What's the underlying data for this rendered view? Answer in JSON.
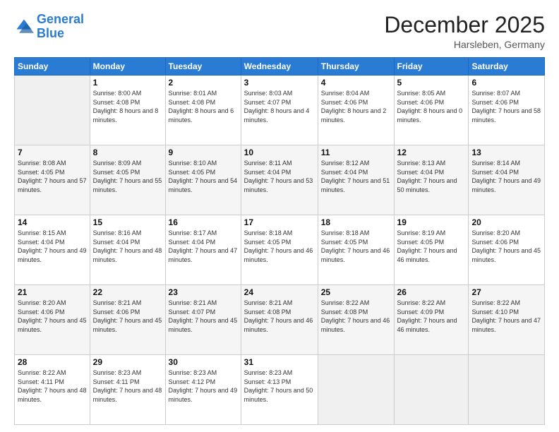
{
  "logo": {
    "line1": "General",
    "line2": "Blue"
  },
  "title": "December 2025",
  "location": "Harsleben, Germany",
  "header_days": [
    "Sunday",
    "Monday",
    "Tuesday",
    "Wednesday",
    "Thursday",
    "Friday",
    "Saturday"
  ],
  "weeks": [
    [
      {
        "day": "",
        "sunrise": "",
        "sunset": "",
        "daylight": ""
      },
      {
        "day": "1",
        "sunrise": "Sunrise: 8:00 AM",
        "sunset": "Sunset: 4:08 PM",
        "daylight": "Daylight: 8 hours and 8 minutes."
      },
      {
        "day": "2",
        "sunrise": "Sunrise: 8:01 AM",
        "sunset": "Sunset: 4:08 PM",
        "daylight": "Daylight: 8 hours and 6 minutes."
      },
      {
        "day": "3",
        "sunrise": "Sunrise: 8:03 AM",
        "sunset": "Sunset: 4:07 PM",
        "daylight": "Daylight: 8 hours and 4 minutes."
      },
      {
        "day": "4",
        "sunrise": "Sunrise: 8:04 AM",
        "sunset": "Sunset: 4:06 PM",
        "daylight": "Daylight: 8 hours and 2 minutes."
      },
      {
        "day": "5",
        "sunrise": "Sunrise: 8:05 AM",
        "sunset": "Sunset: 4:06 PM",
        "daylight": "Daylight: 8 hours and 0 minutes."
      },
      {
        "day": "6",
        "sunrise": "Sunrise: 8:07 AM",
        "sunset": "Sunset: 4:06 PM",
        "daylight": "Daylight: 7 hours and 58 minutes."
      }
    ],
    [
      {
        "day": "7",
        "sunrise": "Sunrise: 8:08 AM",
        "sunset": "Sunset: 4:05 PM",
        "daylight": "Daylight: 7 hours and 57 minutes."
      },
      {
        "day": "8",
        "sunrise": "Sunrise: 8:09 AM",
        "sunset": "Sunset: 4:05 PM",
        "daylight": "Daylight: 7 hours and 55 minutes."
      },
      {
        "day": "9",
        "sunrise": "Sunrise: 8:10 AM",
        "sunset": "Sunset: 4:05 PM",
        "daylight": "Daylight: 7 hours and 54 minutes."
      },
      {
        "day": "10",
        "sunrise": "Sunrise: 8:11 AM",
        "sunset": "Sunset: 4:04 PM",
        "daylight": "Daylight: 7 hours and 53 minutes."
      },
      {
        "day": "11",
        "sunrise": "Sunrise: 8:12 AM",
        "sunset": "Sunset: 4:04 PM",
        "daylight": "Daylight: 7 hours and 51 minutes."
      },
      {
        "day": "12",
        "sunrise": "Sunrise: 8:13 AM",
        "sunset": "Sunset: 4:04 PM",
        "daylight": "Daylight: 7 hours and 50 minutes."
      },
      {
        "day": "13",
        "sunrise": "Sunrise: 8:14 AM",
        "sunset": "Sunset: 4:04 PM",
        "daylight": "Daylight: 7 hours and 49 minutes."
      }
    ],
    [
      {
        "day": "14",
        "sunrise": "Sunrise: 8:15 AM",
        "sunset": "Sunset: 4:04 PM",
        "daylight": "Daylight: 7 hours and 49 minutes."
      },
      {
        "day": "15",
        "sunrise": "Sunrise: 8:16 AM",
        "sunset": "Sunset: 4:04 PM",
        "daylight": "Daylight: 7 hours and 48 minutes."
      },
      {
        "day": "16",
        "sunrise": "Sunrise: 8:17 AM",
        "sunset": "Sunset: 4:04 PM",
        "daylight": "Daylight: 7 hours and 47 minutes."
      },
      {
        "day": "17",
        "sunrise": "Sunrise: 8:18 AM",
        "sunset": "Sunset: 4:05 PM",
        "daylight": "Daylight: 7 hours and 46 minutes."
      },
      {
        "day": "18",
        "sunrise": "Sunrise: 8:18 AM",
        "sunset": "Sunset: 4:05 PM",
        "daylight": "Daylight: 7 hours and 46 minutes."
      },
      {
        "day": "19",
        "sunrise": "Sunrise: 8:19 AM",
        "sunset": "Sunset: 4:05 PM",
        "daylight": "Daylight: 7 hours and 46 minutes."
      },
      {
        "day": "20",
        "sunrise": "Sunrise: 8:20 AM",
        "sunset": "Sunset: 4:06 PM",
        "daylight": "Daylight: 7 hours and 45 minutes."
      }
    ],
    [
      {
        "day": "21",
        "sunrise": "Sunrise: 8:20 AM",
        "sunset": "Sunset: 4:06 PM",
        "daylight": "Daylight: 7 hours and 45 minutes."
      },
      {
        "day": "22",
        "sunrise": "Sunrise: 8:21 AM",
        "sunset": "Sunset: 4:06 PM",
        "daylight": "Daylight: 7 hours and 45 minutes."
      },
      {
        "day": "23",
        "sunrise": "Sunrise: 8:21 AM",
        "sunset": "Sunset: 4:07 PM",
        "daylight": "Daylight: 7 hours and 45 minutes."
      },
      {
        "day": "24",
        "sunrise": "Sunrise: 8:21 AM",
        "sunset": "Sunset: 4:08 PM",
        "daylight": "Daylight: 7 hours and 46 minutes."
      },
      {
        "day": "25",
        "sunrise": "Sunrise: 8:22 AM",
        "sunset": "Sunset: 4:08 PM",
        "daylight": "Daylight: 7 hours and 46 minutes."
      },
      {
        "day": "26",
        "sunrise": "Sunrise: 8:22 AM",
        "sunset": "Sunset: 4:09 PM",
        "daylight": "Daylight: 7 hours and 46 minutes."
      },
      {
        "day": "27",
        "sunrise": "Sunrise: 8:22 AM",
        "sunset": "Sunset: 4:10 PM",
        "daylight": "Daylight: 7 hours and 47 minutes."
      }
    ],
    [
      {
        "day": "28",
        "sunrise": "Sunrise: 8:22 AM",
        "sunset": "Sunset: 4:11 PM",
        "daylight": "Daylight: 7 hours and 48 minutes."
      },
      {
        "day": "29",
        "sunrise": "Sunrise: 8:23 AM",
        "sunset": "Sunset: 4:11 PM",
        "daylight": "Daylight: 7 hours and 48 minutes."
      },
      {
        "day": "30",
        "sunrise": "Sunrise: 8:23 AM",
        "sunset": "Sunset: 4:12 PM",
        "daylight": "Daylight: 7 hours and 49 minutes."
      },
      {
        "day": "31",
        "sunrise": "Sunrise: 8:23 AM",
        "sunset": "Sunset: 4:13 PM",
        "daylight": "Daylight: 7 hours and 50 minutes."
      },
      {
        "day": "",
        "sunrise": "",
        "sunset": "",
        "daylight": ""
      },
      {
        "day": "",
        "sunrise": "",
        "sunset": "",
        "daylight": ""
      },
      {
        "day": "",
        "sunrise": "",
        "sunset": "",
        "daylight": ""
      }
    ]
  ]
}
